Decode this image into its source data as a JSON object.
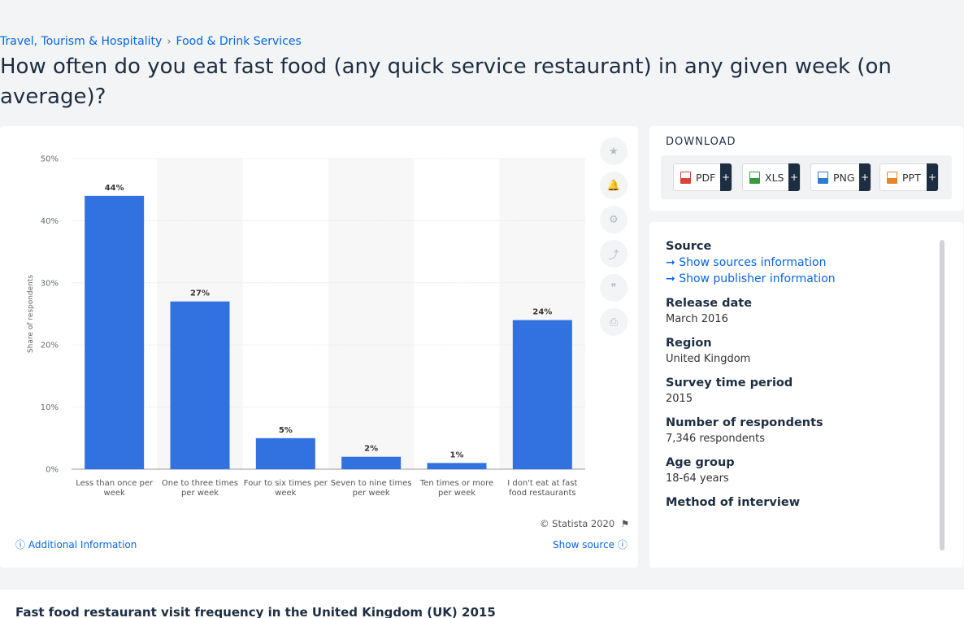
{
  "breadcrumb": {
    "parent": "Travel, Tourism & Hospitality",
    "child": "Food & Drink Services",
    "sep": "›"
  },
  "page_title": "How often do you eat fast food (any quick service restaurant) in any given week (on average)?",
  "chart_data": {
    "type": "bar",
    "categories": [
      "Less than once per week",
      "One to three times per week",
      "Four to six times per week",
      "Seven to nine times per week",
      "Ten times or more per week",
      "I don't eat at fast food restaurants"
    ],
    "category_lines": [
      [
        "Less than once per",
        "week"
      ],
      [
        "One to three times",
        "per week"
      ],
      [
        "Four to six times per",
        "week"
      ],
      [
        "Seven to nine times",
        "per week"
      ],
      [
        "Ten times or more",
        "per week"
      ],
      [
        "I don't eat at fast",
        "food restaurants"
      ]
    ],
    "values": [
      44,
      27,
      5,
      2,
      1,
      24
    ],
    "value_labels": [
      "44%",
      "27%",
      "5%",
      "2%",
      "1%",
      "24%"
    ],
    "ylabel": "Share of respondents",
    "ylim": [
      0,
      50
    ],
    "yticks": [
      0,
      10,
      20,
      30,
      40,
      50
    ],
    "ytick_labels": [
      "0%",
      "10%",
      "20%",
      "30%",
      "40%",
      "50%"
    ],
    "grid": true,
    "bar_color": "#3172e0"
  },
  "chart_footer": {
    "copyright": "© Statista 2020",
    "additional_info": "Additional Information",
    "show_source": "Show source"
  },
  "tools": [
    {
      "name": "star-icon",
      "glyph": "★"
    },
    {
      "name": "bell-icon",
      "glyph": "🔔"
    },
    {
      "name": "gear-icon",
      "glyph": "⚙"
    },
    {
      "name": "share-icon",
      "glyph": "⤴"
    },
    {
      "name": "quote-icon",
      "glyph": "❞"
    },
    {
      "name": "print-icon",
      "glyph": "⎙"
    }
  ],
  "download": {
    "title": "DOWNLOAD",
    "buttons": [
      {
        "label": "PDF",
        "color": "#d9433a"
      },
      {
        "label": "XLS",
        "color": "#3b9a3e"
      },
      {
        "label": "PNG",
        "color": "#2f7ad6"
      },
      {
        "label": "PPT",
        "color": "#e8862a"
      }
    ],
    "plus": "+"
  },
  "info": {
    "source_label": "Source",
    "sources_link": "Show sources information",
    "publisher_link": "Show publisher information",
    "release_label": "Release date",
    "release_value": "March 2016",
    "region_label": "Region",
    "region_value": "United Kingdom",
    "survey_label": "Survey time period",
    "survey_value": "2015",
    "respondents_label": "Number of respondents",
    "respondents_value": "7,346 respondents",
    "age_label": "Age group",
    "age_value": "18-64 years",
    "method_label": "Method of interview"
  },
  "bottom_title": "Fast food restaurant visit frequency in the United Kingdom (UK) 2015"
}
